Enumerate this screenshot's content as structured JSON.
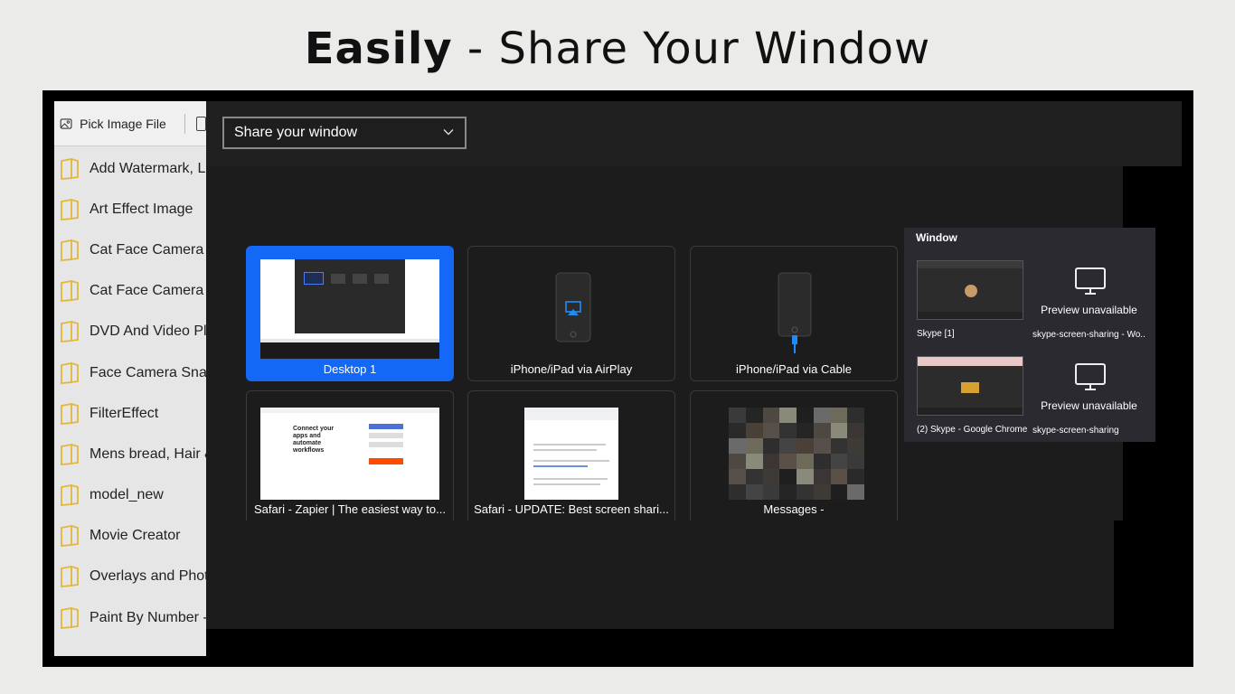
{
  "headline": {
    "bold": "Easily",
    "rest": " - Share Your Window"
  },
  "toolbar": {
    "pick_image_label": "Pick Image File"
  },
  "files": [
    "Add Watermark, Lo",
    "Art Effect Image",
    "Cat Face Camera",
    "Cat Face Camera E",
    "DVD And Video Pla",
    "Face Camera Snap",
    "FilterEffect",
    "Mens bread, Hair &",
    "model_new",
    "Movie Creator",
    "Overlays and Photo",
    "Paint By Number -"
  ],
  "share": {
    "select_value": "Share your window"
  },
  "tiles": [
    {
      "label": "Desktop 1",
      "selected": true,
      "icon": "desktop-thumbnail"
    },
    {
      "label": "iPhone/iPad via AirPlay",
      "icon": "airplay-phone-icon"
    },
    {
      "label": "iPhone/iPad via Cable",
      "icon": "cable-phone-icon"
    },
    {
      "label": "Safari - Zapier | The easiest way to...",
      "icon": "safari-zapier-thumbnail"
    },
    {
      "label": "Safari - UPDATE: Best screen shari...",
      "icon": "safari-doc-thumbnail"
    },
    {
      "label": "Messages -",
      "icon": "messages-pixelated-thumbnail"
    }
  ],
  "thumb_text": {
    "zapier_heading": "Connect your apps and automate workflows"
  },
  "popup": {
    "title": "Window",
    "items": [
      {
        "label": "Skype [1]",
        "preview": true
      },
      {
        "label": "skype-screen-sharing - Wo...",
        "preview": false,
        "unavailable": "Preview unavailable"
      },
      {
        "label": "(2) Skype - Google Chrome",
        "preview": true
      },
      {
        "label": "skype-screen-sharing",
        "preview": false,
        "unavailable": "Preview unavailable"
      }
    ]
  },
  "colors": {
    "accent": "#1368f5",
    "folder": "#e2b83a",
    "dark_bg": "#1c1c1c"
  }
}
